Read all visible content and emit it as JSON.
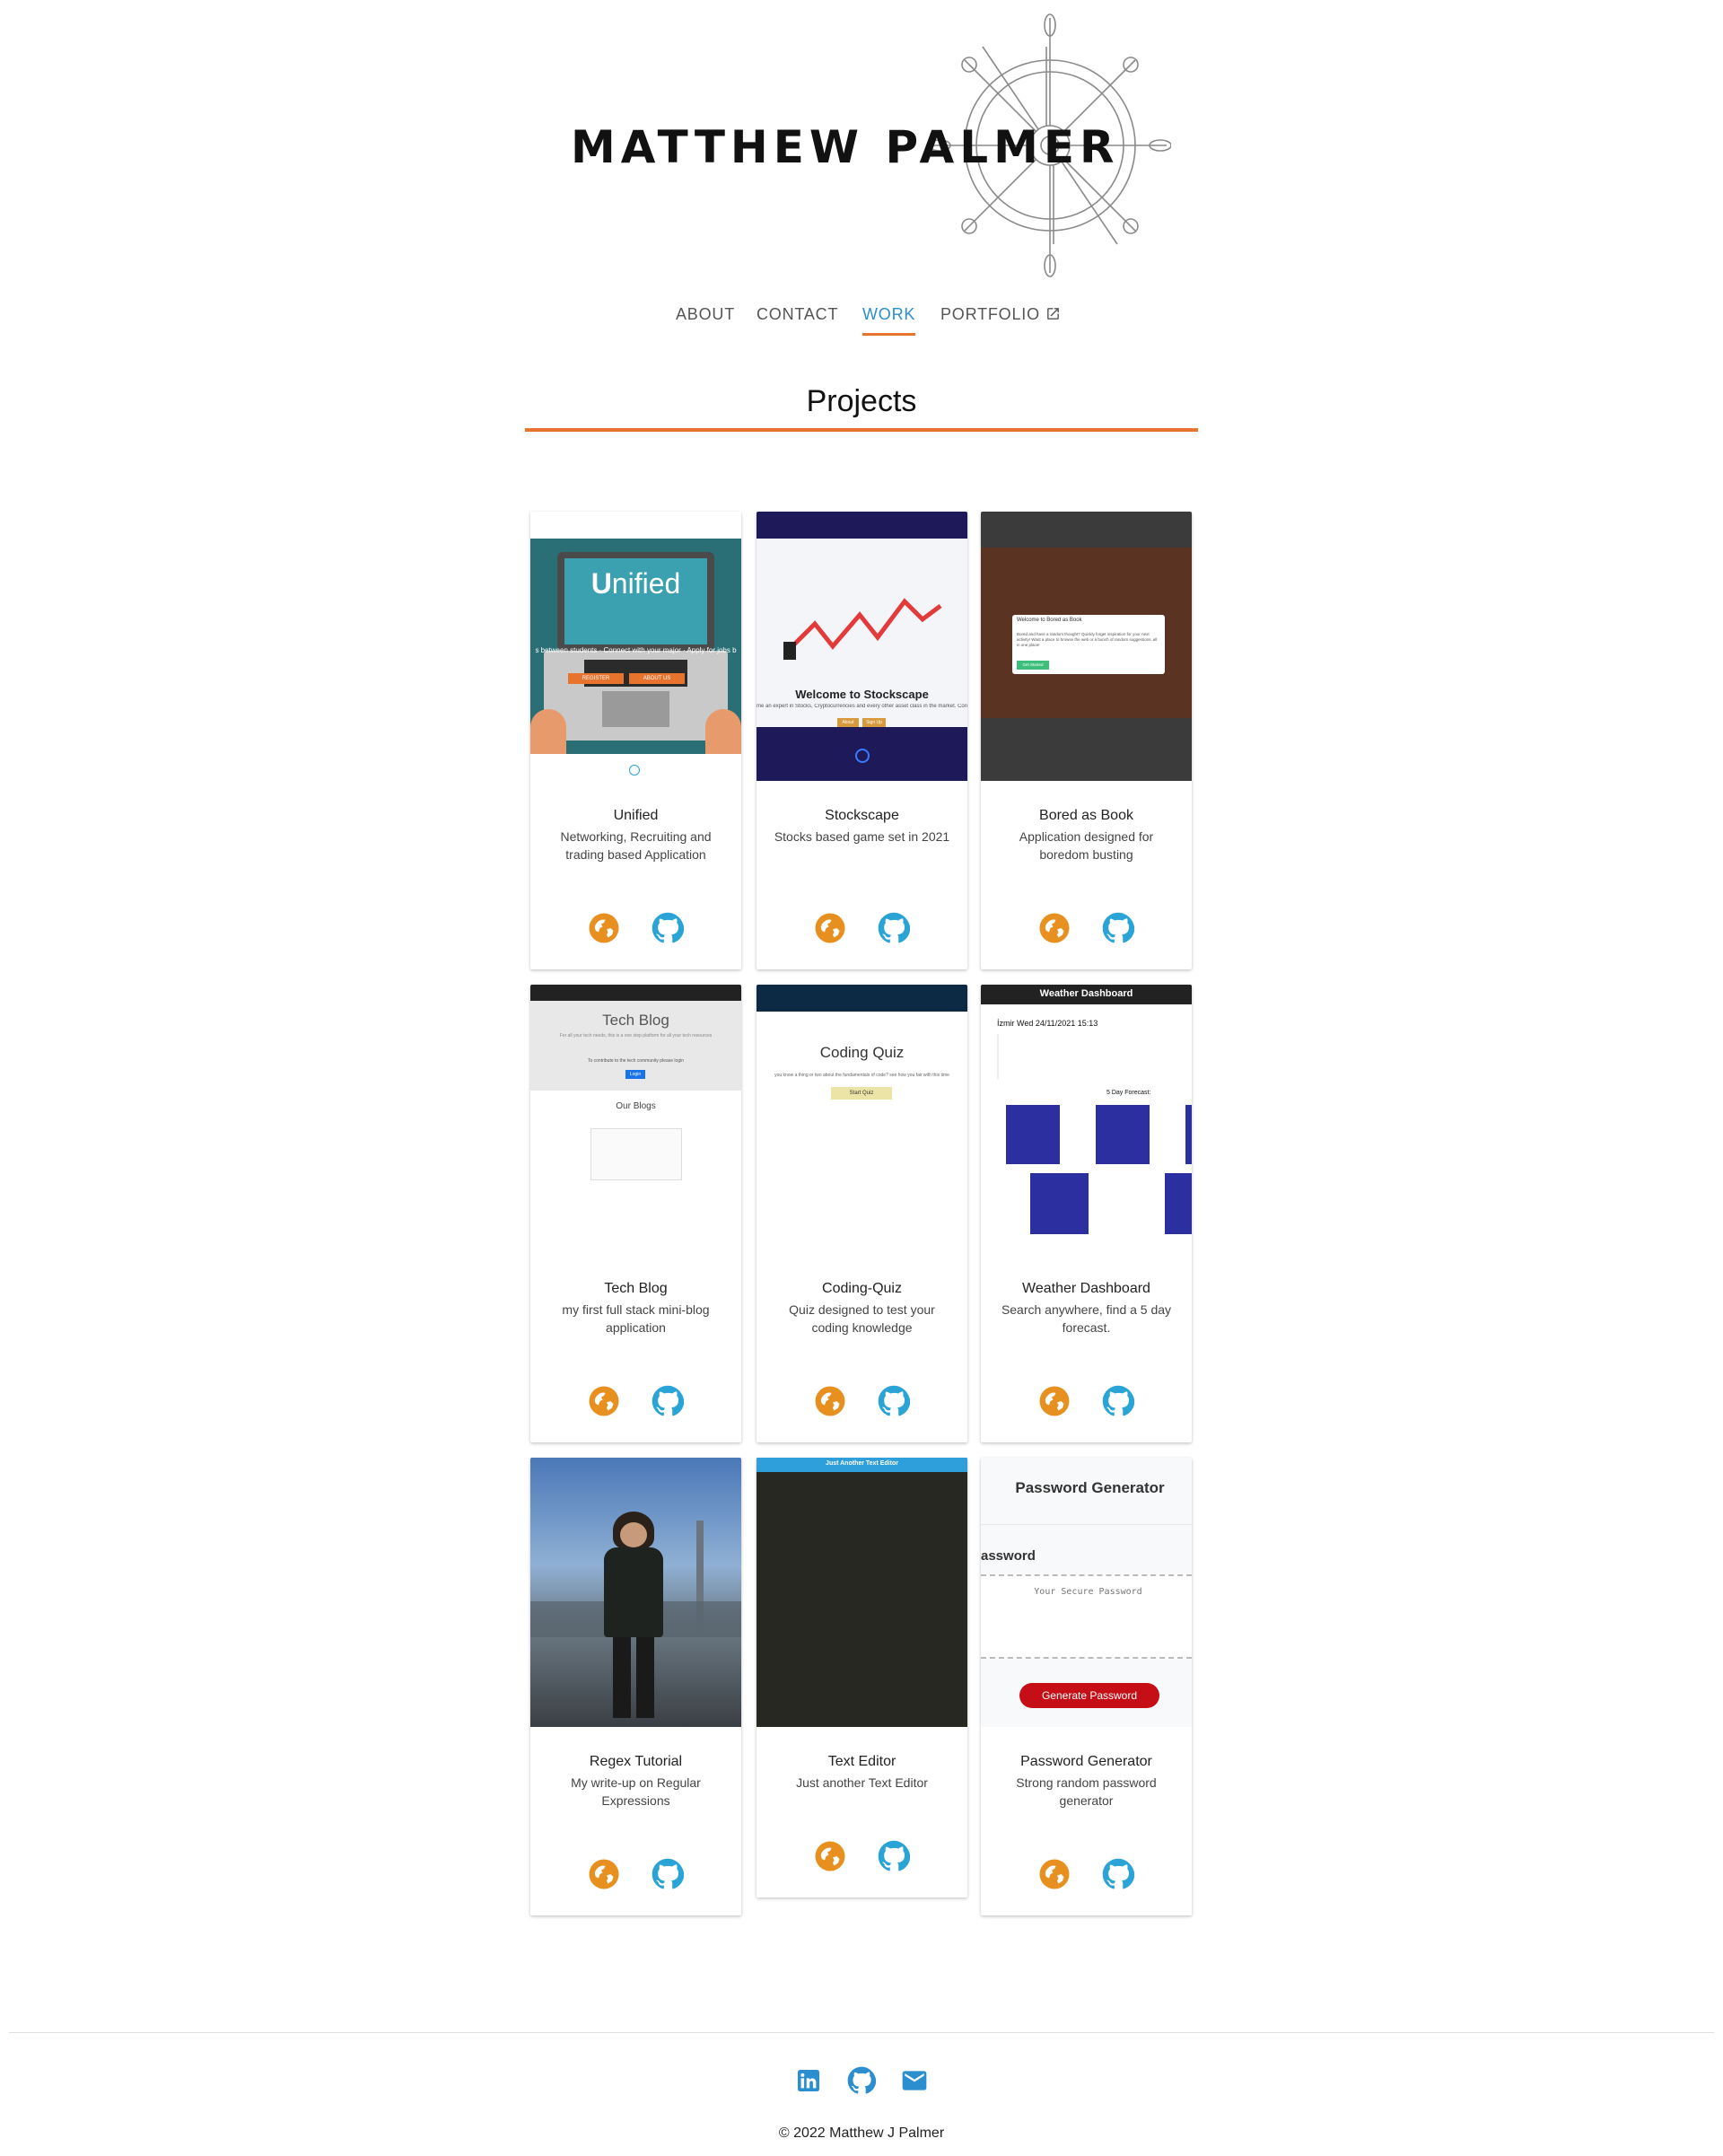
{
  "header": {
    "title": "MATTHEW PALMER"
  },
  "nav": {
    "items": [
      {
        "label": "ABOUT"
      },
      {
        "label": "CONTACT"
      },
      {
        "label": "WORK",
        "active": true
      },
      {
        "label": "PORTFOLIO",
        "external": true
      }
    ]
  },
  "section": {
    "title": "Projects"
  },
  "colors": {
    "accent": "#e8732d",
    "link_blue": "#2b8ecf",
    "web_icon": "#e8901f",
    "github_icon": "#2aa4d6"
  },
  "projects": [
    {
      "title": "Unified",
      "description": "Networking, Recruiting and trading based Application",
      "thumb": {
        "headline": "nified",
        "tagline": "s between students · Connect with your major · Apply for jobs b",
        "buttons": [
          "REGISTER",
          "ABOUT US"
        ]
      }
    },
    {
      "title": "Stockscape",
      "description": "Stocks based game set in 2021",
      "thumb": {
        "headline": "Welcome to Stockscape",
        "tagline": "me an expert in Stocks, Cryptocurrencies and every other asset class in the market. Consider your",
        "buttons": [
          "About",
          "Sign Up"
        ]
      }
    },
    {
      "title": "Bored as Book",
      "description": "Application designed for boredom busting",
      "thumb": {
        "headline": "Welcome to Bored as Book",
        "tagline": "Bored and have a random thought? Quickly forget inspiration for your next activity! Want a place to browse the web or a bunch of random suggestions, all in one place!",
        "buttons": [
          "Get Started"
        ]
      }
    },
    {
      "title": "Tech Blog",
      "description": "my first full stack mini-blog application",
      "thumb": {
        "headline": "Tech Blog",
        "tagline": "For all your tech needs, this is a one stop platform for all your tech resources",
        "buttons": [
          "Login"
        ],
        "subheading": "Our Blogs",
        "note": "To contribute to the tech community please login"
      }
    },
    {
      "title": "Coding-Quiz",
      "description": "Quiz designed to test your coding knowledge",
      "thumb": {
        "headline": "Coding Quiz",
        "tagline": "you know a thing or two about the fundamentals of code? see how you fair with this time",
        "buttons": [
          "Start Quiz"
        ]
      }
    },
    {
      "title": "Weather Dashboard",
      "description": "Search anywhere, find a 5 day forecast.",
      "thumb": {
        "headline": "Weather Dashboard",
        "city": "İzmir Wed 24/11/2021 15:13",
        "subheading": "5 Day Forecast:"
      }
    },
    {
      "title": "Regex Tutorial",
      "description": "My write-up on Regular Expressions",
      "thumb": {}
    },
    {
      "title": "Text Editor",
      "description": "Just another Text Editor",
      "thumb": {
        "headline": "Just Another Text Editor"
      }
    },
    {
      "title": "Password Generator",
      "description": "Strong random password generator",
      "thumb": {
        "headline": "Password Generator",
        "subheading": "assword",
        "placeholder": "Your Secure Password",
        "buttons": [
          "Generate Password"
        ]
      }
    }
  ],
  "footer": {
    "social": [
      "linkedin-icon",
      "github-icon",
      "email-icon"
    ],
    "copyright": "© 2022 Matthew J Palmer"
  }
}
